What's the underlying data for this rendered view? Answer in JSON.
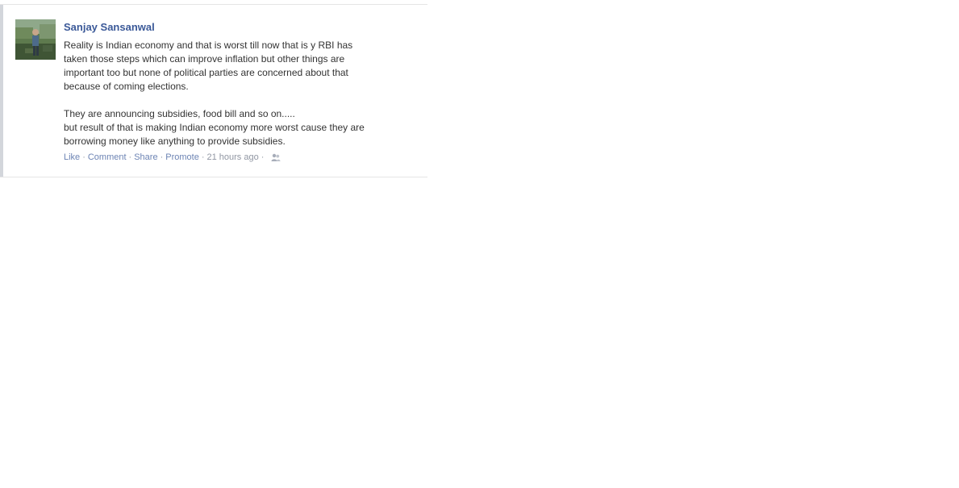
{
  "post": {
    "author": "Sanjay Sansanwal",
    "message_paragraphs": [
      "Reality is Indian economy and that is worst till now that is y RBI has\ntaken those steps which can improve inflation but other things are\nimportant too but none of political parties are concerned about that\nbecause of coming elections.",
      "They are announcing subsidies, food bill and so on.....\nbut result of that is making Indian economy more worst cause they are\nborrowing money like anything to provide subsidies."
    ],
    "actions": {
      "like": "Like",
      "comment": "Comment",
      "share": "Share",
      "promote": "Promote",
      "timestamp": "21 hours ago",
      "separator": "·"
    },
    "icons": {
      "privacy": "friends-privacy-icon",
      "avatar": "profile-photo"
    },
    "colors": {
      "author_link": "#3b5998",
      "action_link": "#6d84b4",
      "meta_text": "#9197a3",
      "body_text": "#333333"
    }
  }
}
